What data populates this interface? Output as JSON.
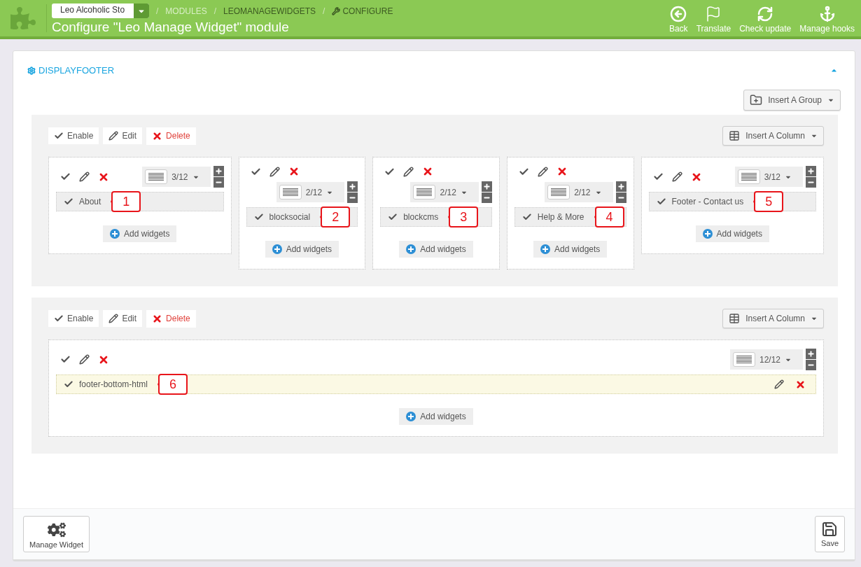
{
  "header": {
    "shop_selector": {
      "value": "Leo Alcoholic Sto"
    },
    "breadcrumb": [
      {
        "separator": "/",
        "label": "MODULES",
        "kind": "link"
      },
      {
        "separator": "/",
        "label": "LEOMANAGEWIDGETS",
        "kind": "module"
      },
      {
        "separator": "/",
        "label": "CONFIGURE",
        "kind": "action"
      }
    ],
    "title": "Configure \"Leo Manage Widget\" module",
    "toolbar": [
      {
        "label": "Back",
        "kind": "back"
      },
      {
        "label": "Translate",
        "kind": "translate"
      },
      {
        "label": "Check update",
        "kind": "update"
      },
      {
        "label": "Manage hooks",
        "kind": "hooks"
      }
    ]
  },
  "panel": {
    "title": "DISPLAYFOOTER",
    "expanded": true,
    "insert_group_button": "Insert A Group",
    "groups": [
      {
        "actions": [
          {
            "label": "Enable",
            "kind": "enable"
          },
          {
            "label": "Edit",
            "kind": "edit"
          },
          {
            "label": "Delete",
            "kind": "delete"
          }
        ],
        "insert_column_button": "Insert A Column",
        "columns": [
          {
            "width": "3/12",
            "widgets": [
              {
                "name": "About",
                "callout": "1",
                "highlighted": false
              }
            ],
            "add_button": "Add widgets"
          },
          {
            "width": "2/12",
            "widgets": [
              {
                "name": "blocksocial",
                "callout": "2",
                "highlighted": false
              }
            ],
            "add_button": "Add widgets"
          },
          {
            "width": "2/12",
            "widgets": [
              {
                "name": "blockcms",
                "callout": "3",
                "highlighted": false
              }
            ],
            "add_button": "Add widgets"
          },
          {
            "width": "2/12",
            "widgets": [
              {
                "name": "Help & More",
                "callout": "4",
                "highlighted": false
              }
            ],
            "add_button": "Add widgets"
          },
          {
            "width": "3/12",
            "widgets": [
              {
                "name": "Footer - Contact us",
                "callout": "5",
                "highlighted": false
              }
            ],
            "add_button": "Add widgets"
          }
        ]
      },
      {
        "actions": [
          {
            "label": "Enable",
            "kind": "enable"
          },
          {
            "label": "Edit",
            "kind": "edit"
          },
          {
            "label": "Delete",
            "kind": "delete"
          }
        ],
        "insert_column_button": "Insert A Column",
        "columns": [
          {
            "width": "12/12",
            "widgets": [
              {
                "name": "footer-bottom-html",
                "callout": "6",
                "highlighted": true
              }
            ],
            "add_button": "Add widgets"
          }
        ]
      }
    ]
  },
  "footer": {
    "buttons": [
      {
        "label": "Manage Widget",
        "kind": "manage"
      },
      {
        "label": "Save",
        "kind": "save"
      }
    ]
  }
}
